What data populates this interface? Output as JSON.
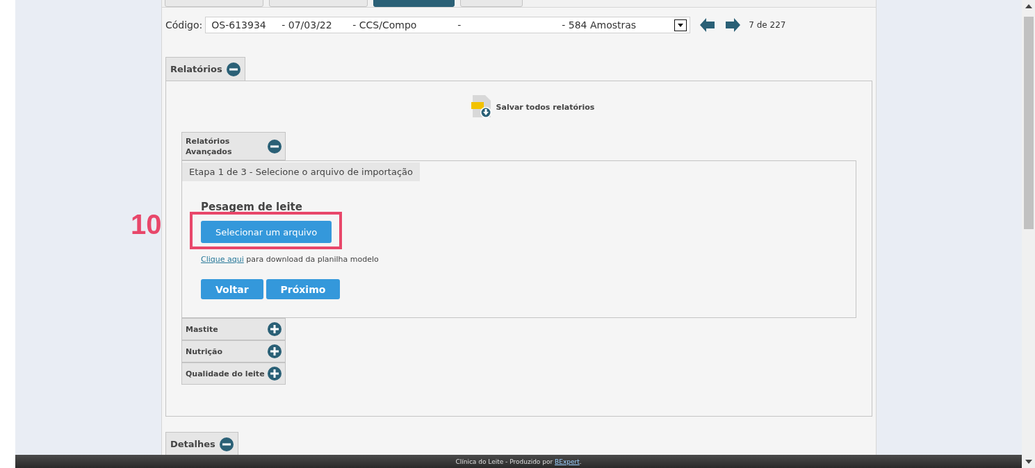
{
  "top_tabs": [
    {
      "selected": false
    },
    {
      "selected": false
    },
    {
      "selected": true
    },
    {
      "selected": false
    }
  ],
  "record_selector": {
    "label": "Código:",
    "value_parts": [
      "OS-613934",
      "- 07/03/22",
      "- CCS/Compo",
      "-",
      "- 584 Amostras"
    ],
    "position": "7 de 227"
  },
  "sections": [
    {
      "title": "Relatórios",
      "expanded": true,
      "save_all": "Salvar todos relatórios",
      "subsections": [
        {
          "title": "Relatórios Avançados",
          "expanded": true,
          "step": "Etapa 1 de 3 - Selecione o arquivo de importação",
          "heading": "Pesagem de leite",
          "select_button": "Selecionar um arquivo",
          "link": "Clique aqui",
          "link_rest": " para download da planilha modelo",
          "buttons": [
            "Voltar",
            "Próximo"
          ]
        },
        {
          "title": "Mastite",
          "expanded": false
        },
        {
          "title": "Nutrição",
          "expanded": false
        },
        {
          "title": "Qualidade do leite",
          "expanded": false
        }
      ]
    },
    {
      "title": "Detalhes",
      "expanded": true
    }
  ],
  "annotation": {
    "number": "10"
  },
  "footer": {
    "text": "Clínica do Leite - Produzido por",
    "link": "BExpert",
    "suffix": "."
  }
}
